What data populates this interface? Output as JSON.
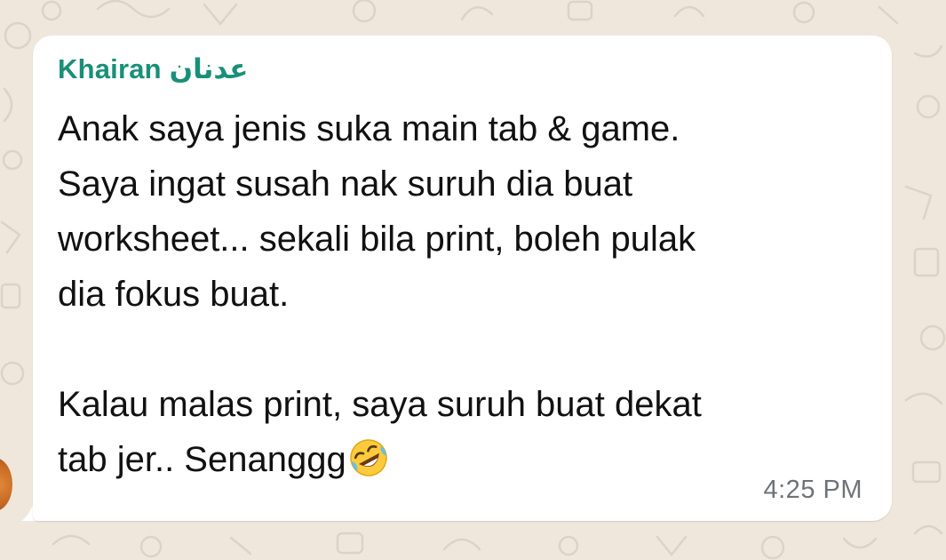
{
  "chat": {
    "sender_name": "Khairan عدنان",
    "message_lines": [
      "Anak saya jenis suka main tab & game.",
      "Saya ingat susah nak suruh dia buat",
      "worksheet... sekali bila print, boleh pulak",
      "dia fokus buat.",
      "",
      "Kalau malas print, saya suruh buat dekat",
      "tab jer.. Senanggg"
    ],
    "emoji": "rolling-on-floor-laughing-emoji",
    "timestamp": "4:25 PM"
  },
  "colors": {
    "wallpaper": "#efe7dc",
    "bubble": "#ffffff",
    "sender": "#1a8f78",
    "text": "#111111",
    "timestamp": "#6f7378"
  }
}
